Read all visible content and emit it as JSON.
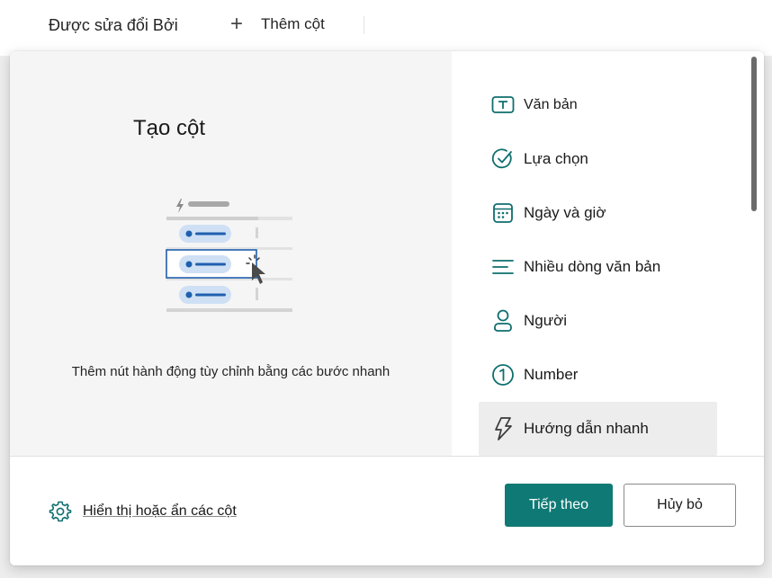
{
  "topbar": {
    "modified_by": "Được sửa đổi Bởi",
    "add_column": "Thêm cột"
  },
  "dialog": {
    "title": "Tạo cột",
    "description": "Thêm nút hành động tùy chỉnh bằng các bước nhanh",
    "column_types": [
      {
        "label": "Văn bản",
        "icon": "text-box-icon"
      },
      {
        "label": "Lựa chọn",
        "icon": "choice-check-icon"
      },
      {
        "label": "Ngày và giờ",
        "icon": "calendar-icon"
      },
      {
        "label": "Nhiều dòng văn bản",
        "icon": "multiline-text-icon"
      },
      {
        "label": "Người",
        "icon": "person-icon"
      },
      {
        "label": "Number",
        "icon": "number-one-icon"
      },
      {
        "label": "Hướng dẫn nhanh",
        "icon": "lightning-icon",
        "selected": true
      }
    ],
    "show_hide_columns": "Hiển thị hoặc ẩn các cột",
    "next_button": "Tiếp theo",
    "cancel_button": "Hủy bỏ"
  },
  "colors": {
    "accent": "#0f7a75",
    "icon": "#0f6f6f",
    "illustration_blue": "#1f5fae",
    "illustration_pill": "#cfe0f5"
  }
}
